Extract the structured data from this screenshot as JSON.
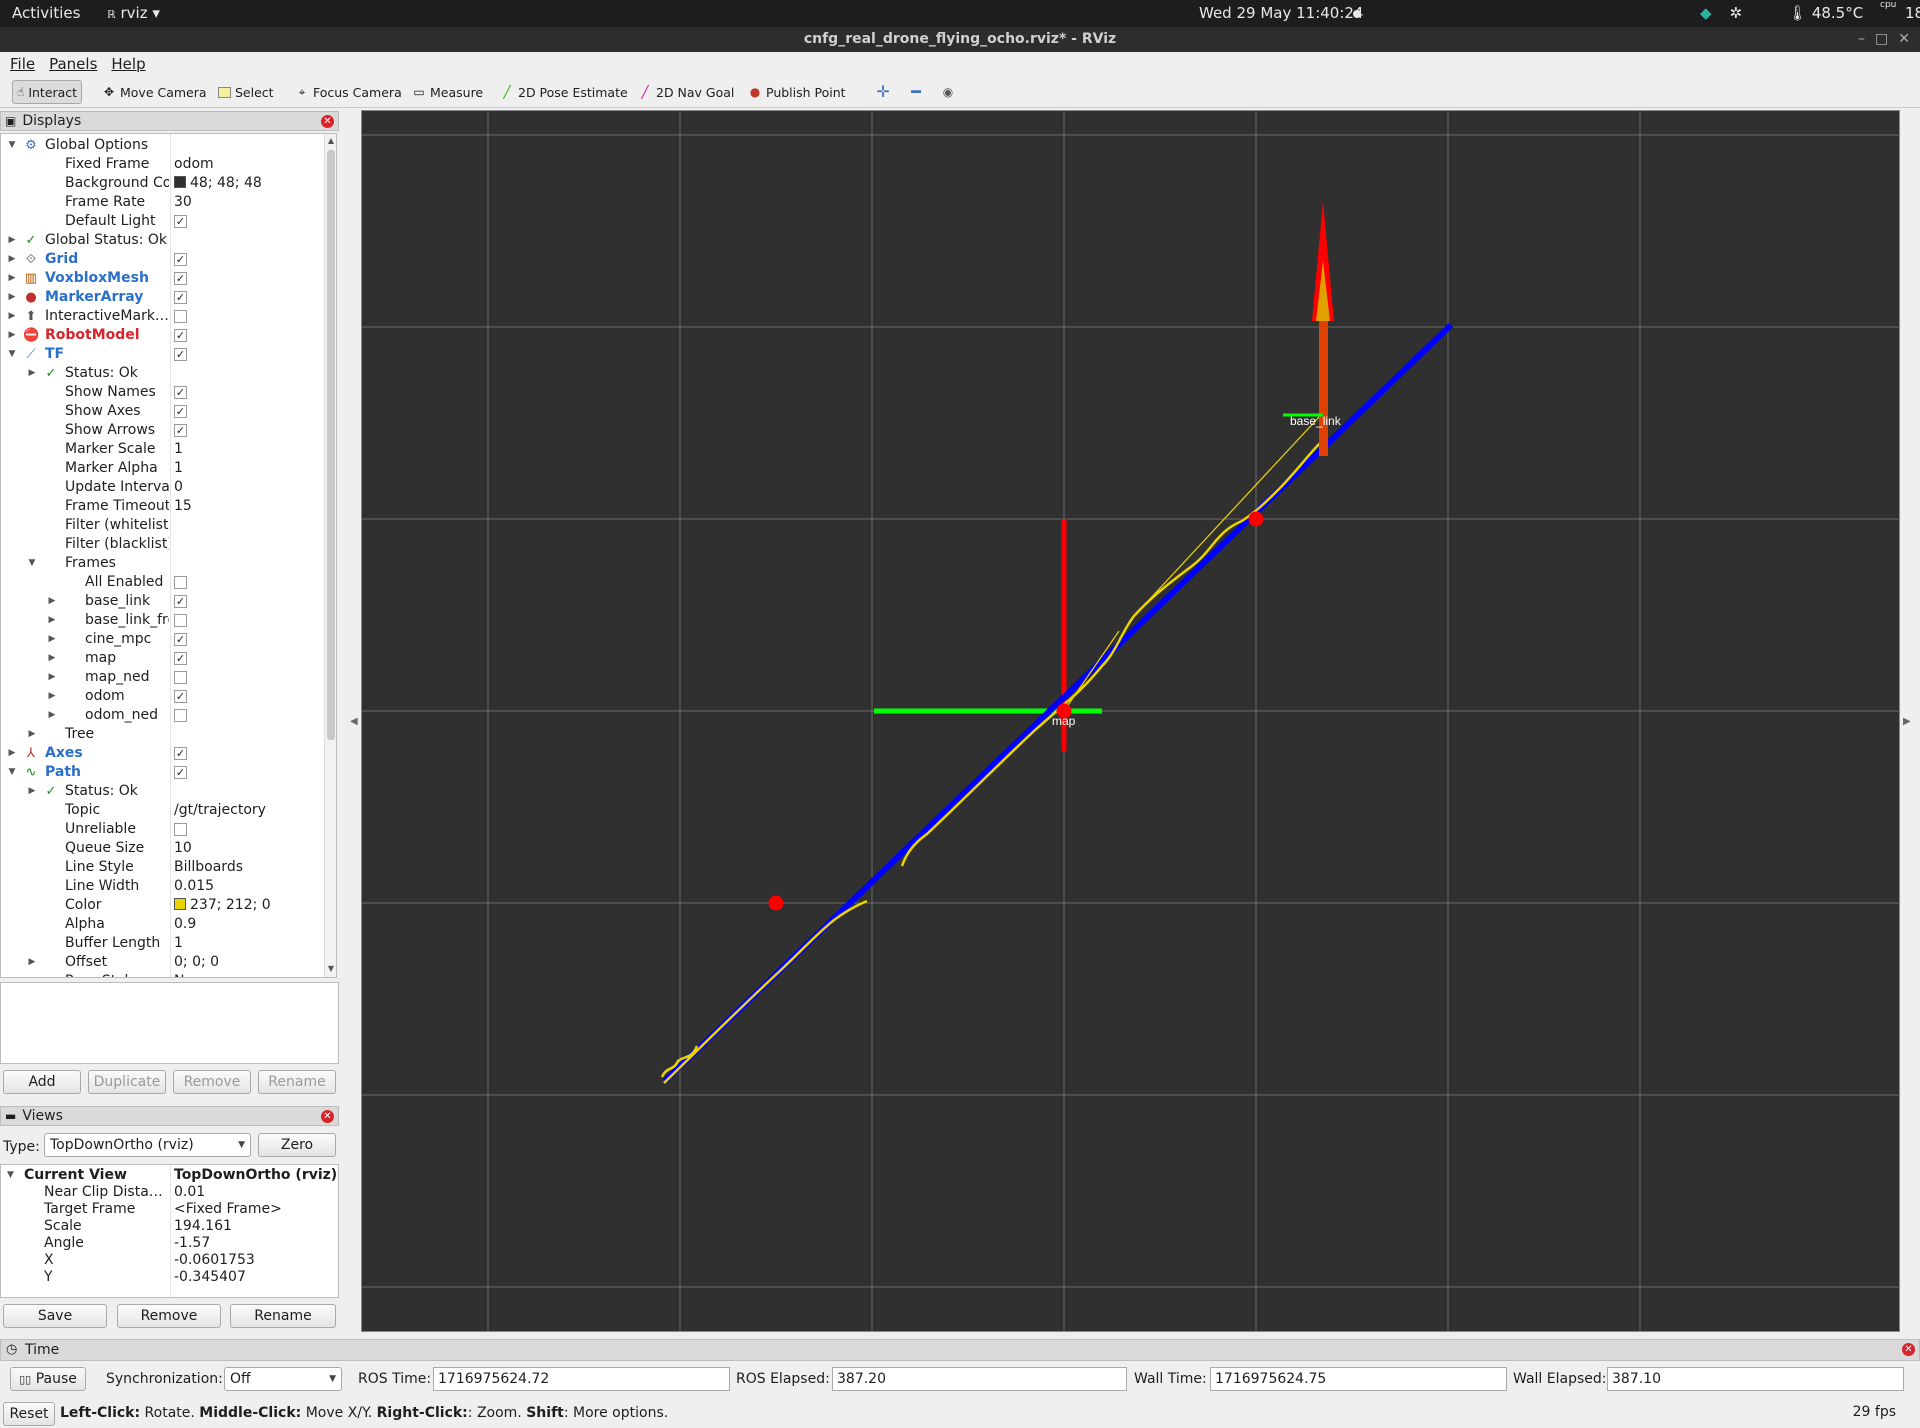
{
  "topbar": {
    "activities": "Activities",
    "app": "rviz",
    "clock": "Wed 29 May  11:40:24",
    "temperature": "48.5°C",
    "cpu": "cpu",
    "cut_text": "18"
  },
  "window": {
    "title": "cnfg_real_drone_flying_ocho.rviz* - RViz"
  },
  "menu": [
    "File",
    "Panels",
    "Help"
  ],
  "toolbar": {
    "interact": "Interact",
    "move_camera": "Move Camera",
    "select": "Select",
    "focus_camera": "Focus Camera",
    "measure": "Measure",
    "pose_estimate": "2D Pose Estimate",
    "nav_goal": "2D Nav Goal",
    "publish_point": "Publish Point"
  },
  "displays": {
    "header": "Displays",
    "rows": [
      {
        "depth": 0,
        "arrow": "open",
        "icon": "gear-icon",
        "label": "Global Options",
        "value": ""
      },
      {
        "depth": 1,
        "label": "Fixed Frame",
        "value": "odom"
      },
      {
        "depth": 1,
        "label": "Background Color",
        "value": "48; 48; 48",
        "swatch": "#303030"
      },
      {
        "depth": 1,
        "label": "Frame Rate",
        "value": "30"
      },
      {
        "depth": 1,
        "label": "Default Light",
        "check": true
      },
      {
        "depth": 0,
        "arrow": "closed",
        "icon": "check-icon",
        "label": "Global Status: Ok",
        "value": ""
      },
      {
        "depth": 0,
        "arrow": "closed",
        "icon": "grid-icon",
        "label": "Grid",
        "check": true,
        "style": "blue"
      },
      {
        "depth": 0,
        "arrow": "closed",
        "icon": "voxblox-icon",
        "label": "VoxbloxMesh",
        "check": true,
        "style": "blue"
      },
      {
        "depth": 0,
        "arrow": "closed",
        "icon": "marker-icon",
        "label": "MarkerArray",
        "check": true,
        "style": "blue"
      },
      {
        "depth": 0,
        "arrow": "closed",
        "icon": "interactive-marker-icon",
        "label": "InteractiveMark…",
        "check": false
      },
      {
        "depth": 0,
        "arrow": "closed",
        "icon": "error-icon",
        "label": "RobotModel",
        "check": true,
        "style": "red"
      },
      {
        "depth": 0,
        "arrow": "open",
        "icon": "tf-icon",
        "label": "TF",
        "check": true,
        "style": "blue"
      },
      {
        "depth": 1,
        "arrow": "closed",
        "icon": "check-icon",
        "label": "Status: Ok",
        "value": ""
      },
      {
        "depth": 1,
        "label": "Show Names",
        "check": true
      },
      {
        "depth": 1,
        "label": "Show Axes",
        "check": true
      },
      {
        "depth": 1,
        "label": "Show Arrows",
        "check": true
      },
      {
        "depth": 1,
        "label": "Marker Scale",
        "value": "1"
      },
      {
        "depth": 1,
        "label": "Marker Alpha",
        "value": "1"
      },
      {
        "depth": 1,
        "label": "Update Interval",
        "value": "0"
      },
      {
        "depth": 1,
        "label": "Frame Timeout",
        "value": "15"
      },
      {
        "depth": 1,
        "label": "Filter (whitelist)",
        "value": ""
      },
      {
        "depth": 1,
        "label": "Filter (blacklist)",
        "value": ""
      },
      {
        "depth": 1,
        "arrow": "open",
        "label": "Frames",
        "value": ""
      },
      {
        "depth": 2,
        "label": "All Enabled",
        "check": false
      },
      {
        "depth": 2,
        "arrow": "closed",
        "label": "base_link",
        "check": true
      },
      {
        "depth": 2,
        "arrow": "closed",
        "label": "base_link_frd",
        "check": false
      },
      {
        "depth": 2,
        "arrow": "closed",
        "label": "cine_mpc",
        "check": true
      },
      {
        "depth": 2,
        "arrow": "closed",
        "label": "map",
        "check": true
      },
      {
        "depth": 2,
        "arrow": "closed",
        "label": "map_ned",
        "check": false
      },
      {
        "depth": 2,
        "arrow": "closed",
        "label": "odom",
        "check": true
      },
      {
        "depth": 2,
        "arrow": "closed",
        "label": "odom_ned",
        "check": false
      },
      {
        "depth": 1,
        "arrow": "closed",
        "label": "Tree",
        "value": ""
      },
      {
        "depth": 0,
        "arrow": "closed",
        "icon": "axes-icon",
        "label": "Axes",
        "check": true,
        "style": "blue"
      },
      {
        "depth": 0,
        "arrow": "open",
        "icon": "path-icon",
        "label": "Path",
        "check": true,
        "style": "blue"
      },
      {
        "depth": 1,
        "arrow": "closed",
        "icon": "check-icon",
        "label": "Status: Ok",
        "value": ""
      },
      {
        "depth": 1,
        "label": "Topic",
        "value": "/gt/trajectory"
      },
      {
        "depth": 1,
        "label": "Unreliable",
        "check": false
      },
      {
        "depth": 1,
        "label": "Queue Size",
        "value": "10"
      },
      {
        "depth": 1,
        "label": "Line Style",
        "value": "Billboards"
      },
      {
        "depth": 1,
        "label": "Line Width",
        "value": "0.015"
      },
      {
        "depth": 1,
        "label": "Color",
        "value": "237; 212; 0",
        "swatch": "#edd400"
      },
      {
        "depth": 1,
        "label": "Alpha",
        "value": "0.9"
      },
      {
        "depth": 1,
        "label": "Buffer Length",
        "value": "1"
      },
      {
        "depth": 1,
        "arrow": "closed",
        "label": "Offset",
        "value": "0; 0; 0"
      },
      {
        "depth": 1,
        "label": "Pose Style",
        "value": "None"
      }
    ],
    "buttons": {
      "add": "Add",
      "duplicate": "Duplicate",
      "remove": "Remove",
      "rename": "Rename"
    }
  },
  "views": {
    "header": "Views",
    "type_label": "Type:",
    "type_value": "TopDownOrtho (rviz)",
    "zero": "Zero",
    "current_view": "Current View",
    "current_view_value": "TopDownOrtho (rviz)",
    "rows": [
      {
        "label": "Near Clip Dista…",
        "value": "0.01"
      },
      {
        "label": "Target Frame",
        "value": "<Fixed Frame>"
      },
      {
        "label": "Scale",
        "value": "194.161"
      },
      {
        "label": "Angle",
        "value": "-1.57"
      },
      {
        "label": "X",
        "value": "-0.0601753"
      },
      {
        "label": "Y",
        "value": "-0.345407"
      }
    ],
    "buttons": {
      "save": "Save",
      "remove": "Remove",
      "rename": "Rename"
    }
  },
  "scene": {
    "label_map": "map",
    "label_base": "base_link",
    "colors": {
      "grid": "#a0a0a0",
      "path": "#0000ff",
      "trajectory": "#edd400",
      "x_axis": "#ff0000",
      "y_axis": "#00ff00",
      "marker": "#ff0000"
    }
  },
  "time": {
    "header": "Time",
    "pause": "Pause",
    "sync_label": "Synchronization:",
    "sync_value": "Off",
    "ros_time_label": "ROS Time:",
    "ros_time": "1716975624.72",
    "ros_elapsed_label": "ROS Elapsed:",
    "ros_elapsed": "387.20",
    "wall_time_label": "Wall Time:",
    "wall_time": "1716975624.75",
    "wall_elapsed_label": "Wall Elapsed:",
    "wall_elapsed": "387.10"
  },
  "status": {
    "reset": "Reset",
    "hint_parts": [
      {
        "b": "Left-Click:",
        "t": " Rotate. "
      },
      {
        "b": "Middle-Click:",
        "t": " Move X/Y. "
      },
      {
        "b": "Right-Click:",
        "t": ": Zoom. "
      },
      {
        "b": "Shift",
        "t": ": More options."
      }
    ],
    "fps": "29 fps"
  }
}
